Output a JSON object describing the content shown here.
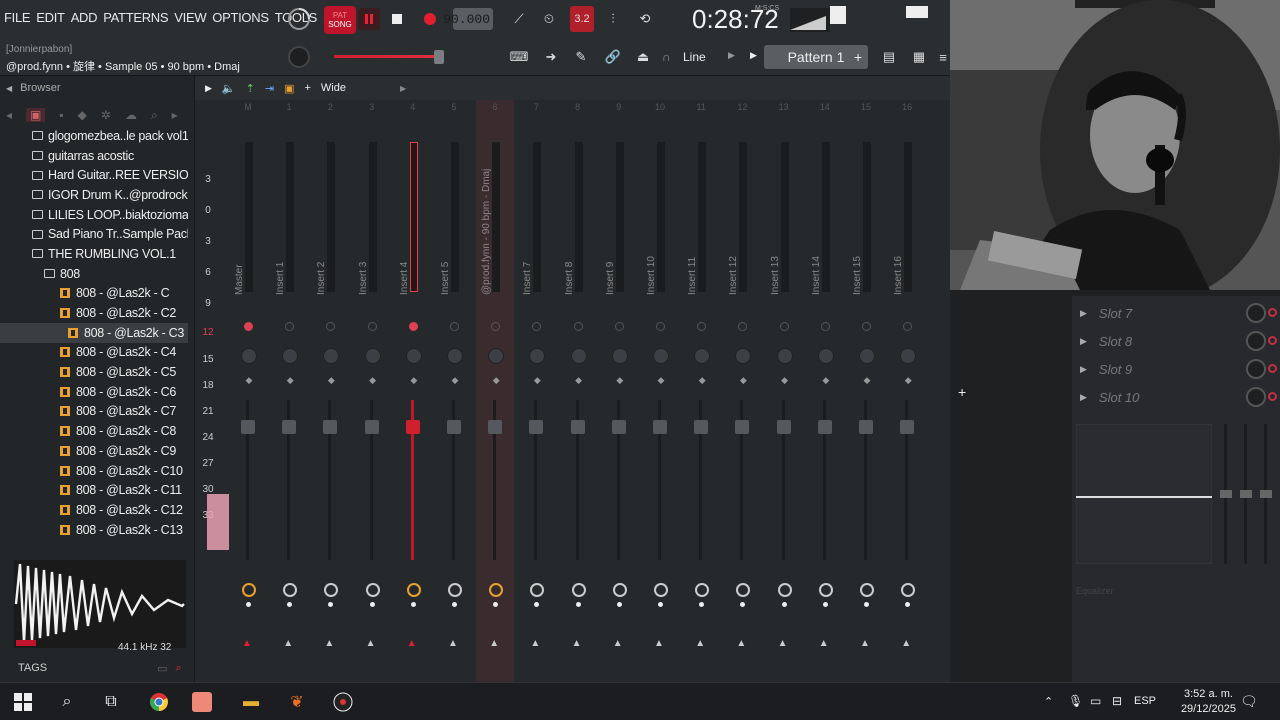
{
  "menu": [
    "FILE",
    "EDIT",
    "ADD",
    "PATTERNS",
    "VIEW",
    "OPTIONS",
    "TOOLS",
    "HELP"
  ],
  "hint": "[Jonnierpabon]",
  "song_info": "@prod.fynn • 旋律 • Sample 05 • 90 bpm • Dmaj",
  "transport": {
    "pat_label": "PAT",
    "song_label": "SONG",
    "tempo": "90.000",
    "timer": "0:28:72",
    "timer_unit": "M:S:CS"
  },
  "pattern": "Pattern 1",
  "line_mode": "Line",
  "browser": {
    "title": "Browser",
    "items": [
      {
        "type": "folder",
        "label": "glogomezbea..le pack vol1",
        "indent": 1
      },
      {
        "type": "folder",
        "label": "guitarras acostic",
        "indent": 1
      },
      {
        "type": "folder",
        "label": "Hard Guitar..REE VERSION",
        "indent": 1
      },
      {
        "type": "folder",
        "label": "IGOR Drum K..@prodrocka",
        "indent": 1
      },
      {
        "type": "folder",
        "label": "LILIES LOOP..biaktoziomal",
        "indent": 1
      },
      {
        "type": "folder",
        "label": "Sad Piano Tr..Sample Pack",
        "indent": 1
      },
      {
        "type": "folder",
        "label": "THE RUMBLING VOL.1",
        "indent": 1
      },
      {
        "type": "folder",
        "label": "808",
        "indent": 2
      },
      {
        "type": "file",
        "label": "808 - @Las2k - C",
        "indent": 3
      },
      {
        "type": "file",
        "label": "808 - @Las2k - C2",
        "indent": 3
      },
      {
        "type": "file",
        "label": "808 - @Las2k - C3",
        "indent": 4,
        "selected": true
      },
      {
        "type": "file",
        "label": "808 - @Las2k - C4",
        "indent": 3
      },
      {
        "type": "file",
        "label": "808 - @Las2k - C5",
        "indent": 3
      },
      {
        "type": "file",
        "label": "808 - @Las2k - C6",
        "indent": 3
      },
      {
        "type": "file",
        "label": "808 - @Las2k - C7",
        "indent": 3
      },
      {
        "type": "file",
        "label": "808 - @Las2k - C8",
        "indent": 3
      },
      {
        "type": "file",
        "label": "808 - @Las2k - C9",
        "indent": 3
      },
      {
        "type": "file",
        "label": "808 - @Las2k - C10",
        "indent": 3
      },
      {
        "type": "file",
        "label": "808 - @Las2k - C11",
        "indent": 3
      },
      {
        "type": "file",
        "label": "808 - @Las2k - C12",
        "indent": 3
      },
      {
        "type": "file",
        "label": "808 - @Las2k - C13",
        "indent": 3
      }
    ],
    "sample_info": "44.1 kHz 32",
    "tags_label": "TAGS"
  },
  "mixer": {
    "view_label": "Wide",
    "db_scale": [
      "3",
      "0",
      "3",
      "6",
      "9",
      "12",
      "15",
      "18",
      "21",
      "24",
      "27",
      "30",
      "33"
    ],
    "strips": [
      {
        "num": "M",
        "label": "Master"
      },
      {
        "num": "1",
        "label": "Insert 1"
      },
      {
        "num": "2",
        "label": "Insert 2"
      },
      {
        "num": "3",
        "label": "Insert 3"
      },
      {
        "num": "4",
        "label": "Insert 4"
      },
      {
        "num": "5",
        "label": "Insert 5"
      },
      {
        "num": "6",
        "label": "@prod.fynn - 90 bpm - Dmaj"
      },
      {
        "num": "7",
        "label": "Insert 7"
      },
      {
        "num": "8",
        "label": "Insert 8"
      },
      {
        "num": "9",
        "label": "Insert 9"
      },
      {
        "num": "10",
        "label": "Insert 10"
      },
      {
        "num": "11",
        "label": "Insert 11"
      },
      {
        "num": "12",
        "label": "Insert 12"
      },
      {
        "num": "13",
        "label": "Insert 13"
      },
      {
        "num": "14",
        "label": "Insert 14"
      },
      {
        "num": "15",
        "label": "Insert 15"
      },
      {
        "num": "16",
        "label": "Insert 16"
      }
    ]
  },
  "fx_slots": [
    "Slot 7",
    "Slot 8",
    "Slot 9",
    "Slot 10"
  ],
  "eq_label": "Equalizer",
  "taskbar": {
    "lang": "ESP",
    "time": "3:52 a. m.",
    "date": "29/12/2025"
  },
  "colors": {
    "accent": "#c0142b",
    "selected_strip": "#3a2b2f",
    "bg": "#26292c"
  }
}
